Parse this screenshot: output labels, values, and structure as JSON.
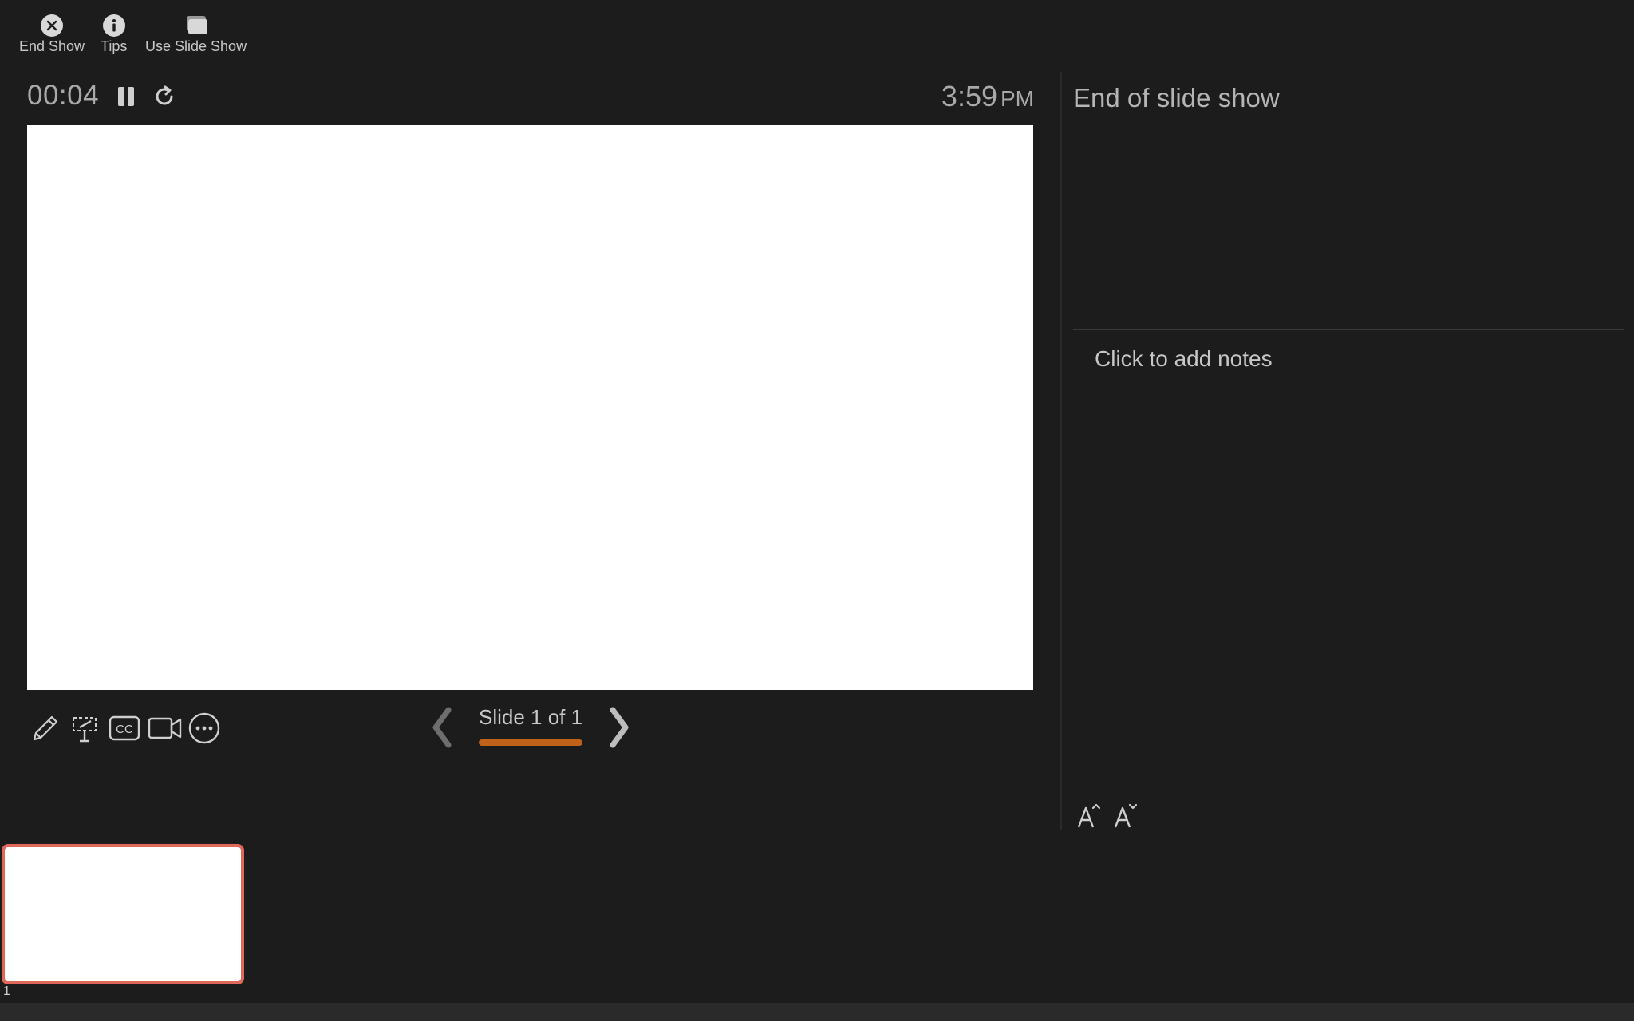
{
  "toolbar": {
    "end_show_label": "End Show",
    "tips_label": "Tips",
    "use_slide_show_label": "Use Slide Show"
  },
  "presenter": {
    "elapsed_time": "00:04",
    "clock_time": "3:59",
    "clock_ampm": "PM"
  },
  "navigation": {
    "slide_counter": "Slide 1 of 1",
    "progress_fraction": 1.0
  },
  "next_panel": {
    "label": "End of slide show"
  },
  "notes": {
    "placeholder": "Click to add notes"
  },
  "filmstrip": {
    "thumbnails": [
      {
        "number": "1"
      }
    ]
  },
  "icons": {
    "end_show": "close-circle-icon",
    "tips": "info-icon",
    "use_slide_show": "slides-stack-icon",
    "pause": "pause-icon",
    "restart": "restart-icon",
    "pen": "pen-icon",
    "laser": "laser-pointer-icon",
    "subtitles": "closed-captions-icon",
    "camera": "camera-icon",
    "more": "more-options-icon",
    "prev": "chevron-left-icon",
    "next": "chevron-right-icon",
    "increase_font": "increase-font-icon",
    "decrease_font": "decrease-font-icon"
  },
  "colors": {
    "background": "#1c1c1c",
    "accent_progress": "#c0621a",
    "thumbnail_selected_border": "#e0685a"
  }
}
